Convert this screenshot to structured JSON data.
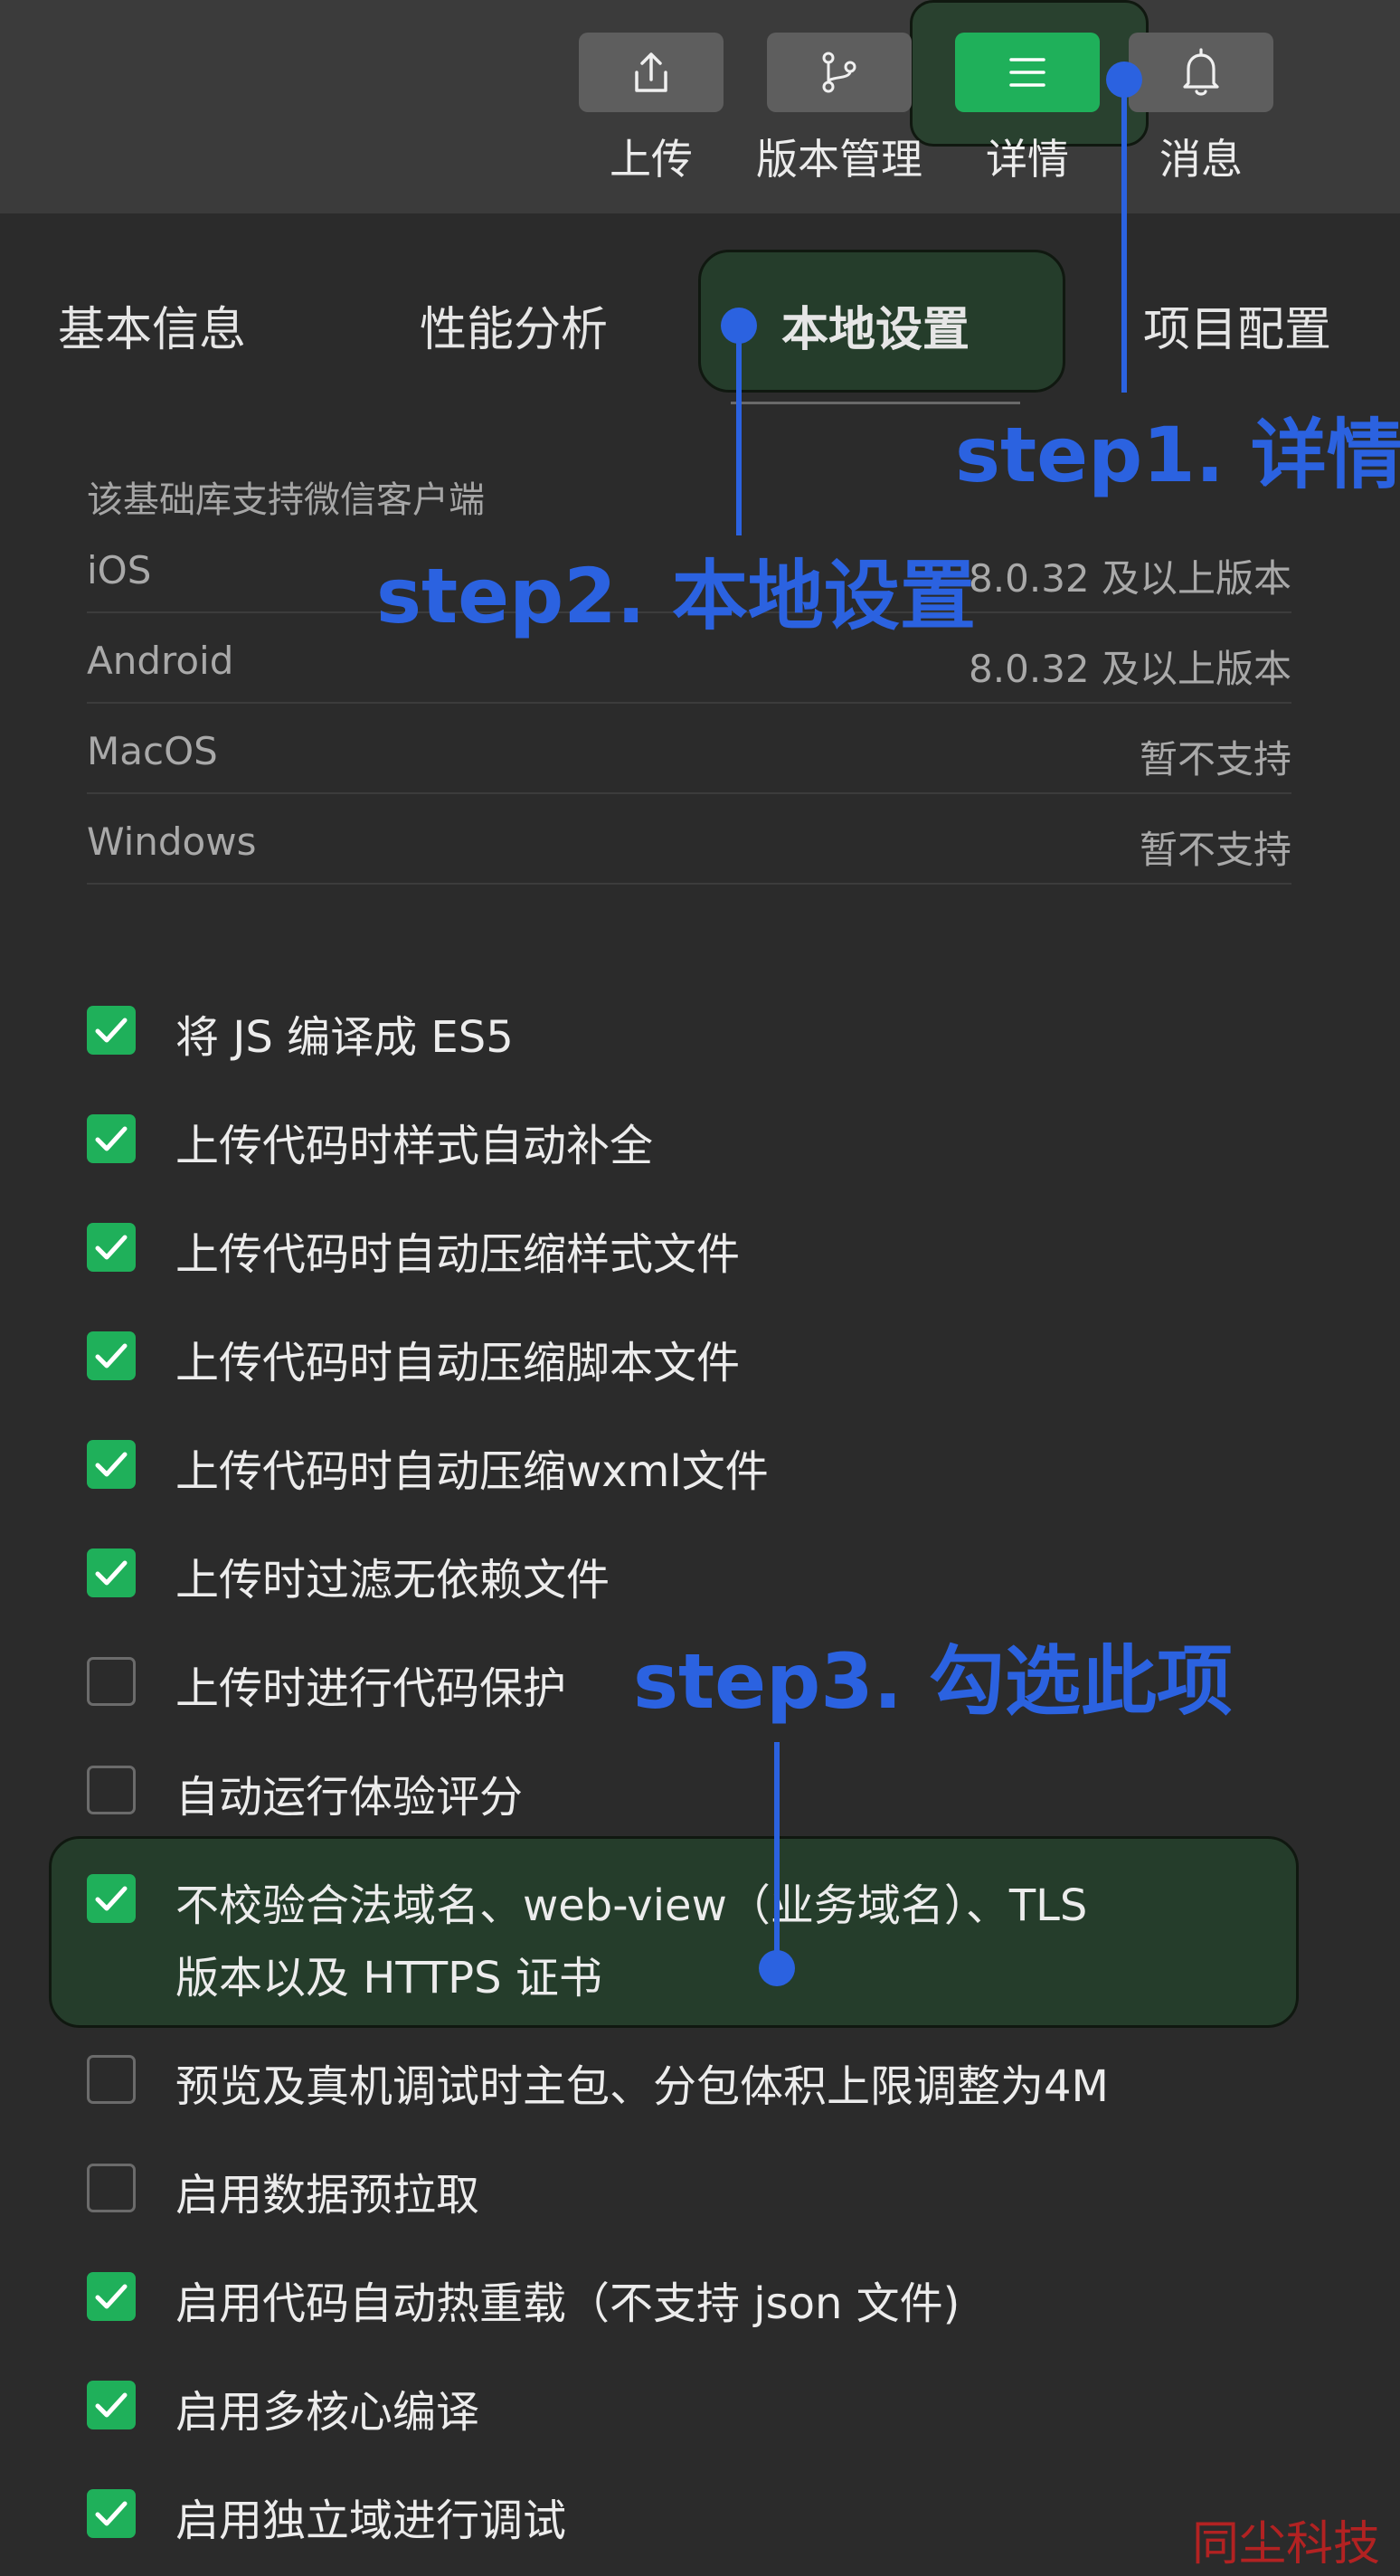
{
  "toolbar": {
    "upload_label": "上传",
    "version_label": "版本管理",
    "details_label": "详情",
    "messages_label": "消息"
  },
  "tabs": {
    "basic": "基本信息",
    "performance": "性能分析",
    "local": "本地设置",
    "project": "项目配置"
  },
  "support": {
    "title": "该基础库支持微信客户端",
    "rows": [
      {
        "platform": "iOS",
        "status": "8.0.32 及以上版本"
      },
      {
        "platform": "Android",
        "status": "8.0.32 及以上版本"
      },
      {
        "platform": "MacOS",
        "status": "暂不支持"
      },
      {
        "platform": "Windows",
        "status": "暂不支持"
      }
    ]
  },
  "options": [
    {
      "label": "将 JS 编译成 ES5",
      "checked": true
    },
    {
      "label": "上传代码时样式自动补全",
      "checked": true
    },
    {
      "label": "上传代码时自动压缩样式文件",
      "checked": true
    },
    {
      "label": "上传代码时自动压缩脚本文件",
      "checked": true
    },
    {
      "label": "上传代码时自动压缩wxml文件",
      "checked": true
    },
    {
      "label": "上传时过滤无依赖文件",
      "checked": true
    },
    {
      "label": "上传时进行代码保护",
      "checked": false
    },
    {
      "label": "自动运行体验评分",
      "checked": false
    },
    {
      "label_line1": "不校验合法域名、web-view（业务域名）、TLS",
      "label_line2": "版本以及 HTTPS 证书",
      "checked": true
    },
    {
      "label": "预览及真机调试时主包、分包体积上限调整为4M",
      "checked": false
    },
    {
      "label": "启用数据预拉取",
      "checked": false
    },
    {
      "label": "启用代码自动热重载（不支持 json 文件)",
      "checked": true
    },
    {
      "label": "启用多核心编译",
      "checked": true
    },
    {
      "label": "启用独立域进行调试",
      "checked": true
    }
  ],
  "annotations": {
    "step1": "step1. 详情",
    "step2": "step2. 本地设置",
    "step3": "step3. 勾选此项"
  },
  "watermark": "同尘科技",
  "colors": {
    "accent_green": "#1fb05a",
    "annotation_blue": "#2b62e0",
    "highlight_green": "#24422c",
    "background": "#2b2b2b",
    "toolbar": "#3b3b3b"
  },
  "icons": [
    "upload-icon",
    "branch-icon",
    "menu-icon",
    "bell-icon",
    "check-icon"
  ]
}
